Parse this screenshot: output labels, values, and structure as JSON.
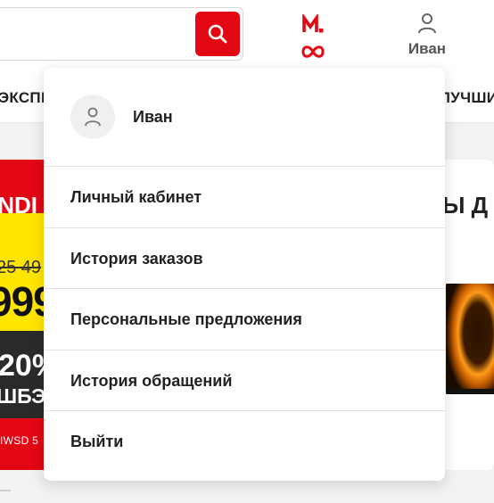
{
  "header": {
    "search_button_icon": "search-icon",
    "logo_icon": "mvideo-logo",
    "user_icon": "user-icon",
    "user_label": "Иван",
    "accent_color": "#e30613"
  },
  "nav": {
    "left_partial": "ЭКСПР",
    "right_partial": "ЛУЧШИ"
  },
  "promo_left": {
    "brand": "INDI",
    "old_price": "25 49",
    "new_price": "999",
    "cashback_percent": "20%",
    "cashback_label": "ШБЭ",
    "model": "IWSD 5"
  },
  "promo_right": {
    "title": "Ы Д"
  },
  "dropdown": {
    "profile_name": "Иван",
    "items": [
      {
        "label": "Личный кабинет"
      },
      {
        "label": "История заказов"
      },
      {
        "label": "Персональные предложения"
      },
      {
        "label": "История обращений"
      },
      {
        "label": "Выйти"
      }
    ]
  }
}
